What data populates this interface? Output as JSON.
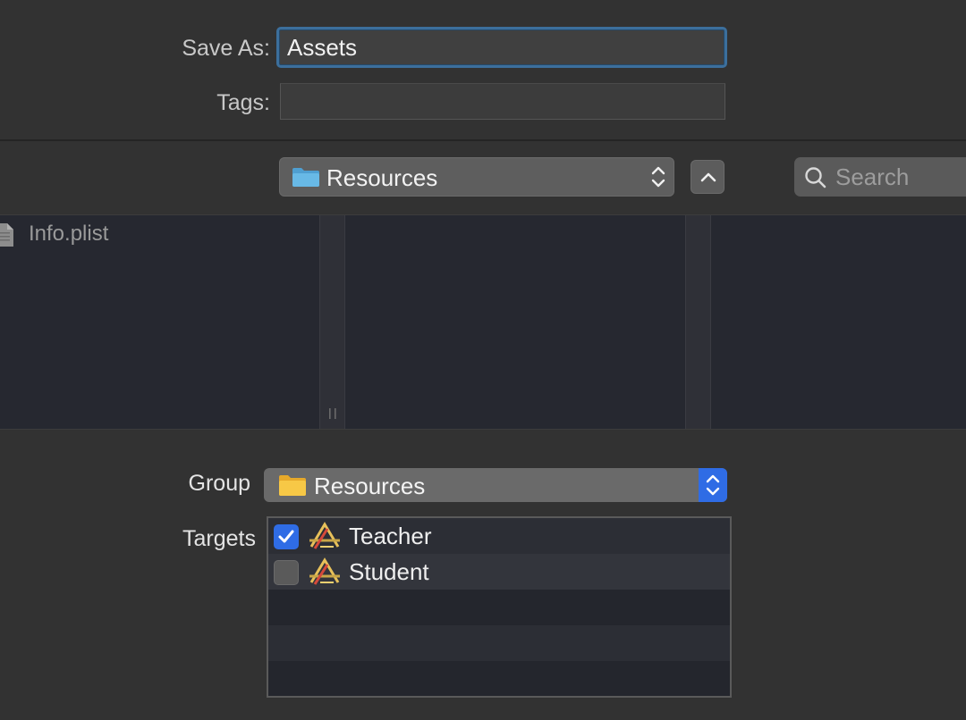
{
  "save_as": {
    "label": "Save As:",
    "value": "Assets"
  },
  "tags": {
    "label": "Tags:",
    "value": ""
  },
  "location_popup": {
    "label": "Resources"
  },
  "search": {
    "placeholder": "Search"
  },
  "browser": {
    "files": [
      {
        "name": "Info.plist",
        "icon": "plist-file-icon"
      }
    ]
  },
  "group": {
    "label": "Group",
    "value": "Resources"
  },
  "targets": {
    "label": "Targets",
    "items": [
      {
        "name": "Teacher",
        "checked": true
      },
      {
        "name": "Student",
        "checked": false
      }
    ]
  },
  "colors": {
    "accent": "#2f6ce5",
    "focus_ring": "#3c6f9c",
    "folder_blue": "#5fb4e4",
    "folder_yellow": "#f5c43a"
  }
}
